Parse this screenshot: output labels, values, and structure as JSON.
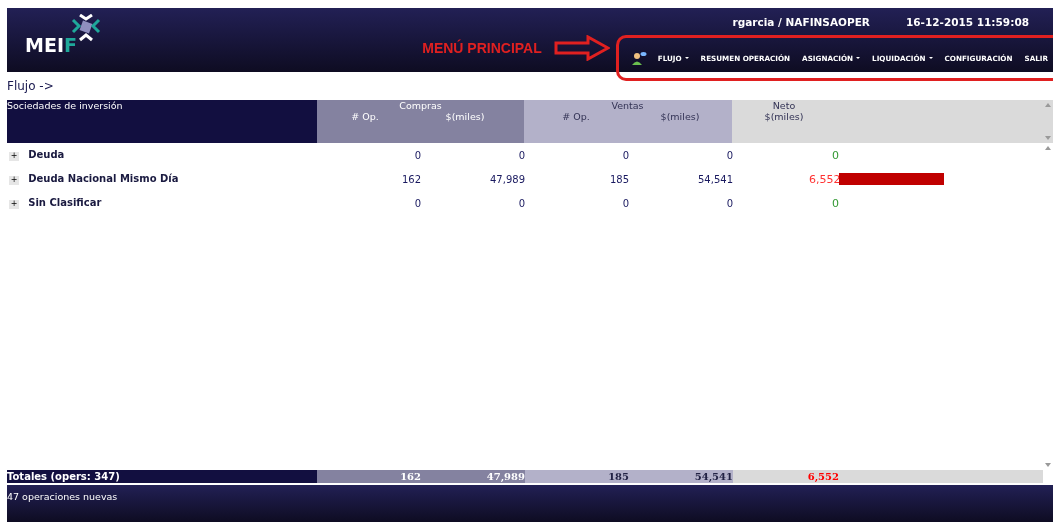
{
  "header": {
    "logo": {
      "text": "MEI",
      "accent": "F"
    },
    "user": "rgarcia / NAFINSAOPER",
    "datetime": "16-12-2015 11:59:08",
    "annotation": "MENÚ PRINCIPAL",
    "menu": [
      {
        "label": "FLUJO",
        "dropdown": true
      },
      {
        "label": "RESUMEN OPERACIÓN",
        "dropdown": false
      },
      {
        "label": "ASIGNACIÓN",
        "dropdown": true
      },
      {
        "label": "LIQUIDACIÓN",
        "dropdown": true
      },
      {
        "label": "CONFIGURACIÓN",
        "dropdown": false
      },
      {
        "label": "SALIR",
        "dropdown": false
      }
    ]
  },
  "breadcrumb": "Flujo ->",
  "table": {
    "name_header": "Sociedades de inversión",
    "groups": [
      {
        "label": "Compras",
        "columns": [
          "# Op.",
          "$(miles)"
        ]
      },
      {
        "label": "Ventas",
        "columns": [
          "# Op.",
          "$(miles)"
        ]
      },
      {
        "label": "Neto",
        "columns": [
          "$(miles)"
        ]
      }
    ],
    "rows": [
      {
        "expand": "+",
        "name": "Deuda",
        "compras_op": "0",
        "compras_monto": "0",
        "ventas_op": "0",
        "ventas_monto": "0",
        "neto": "0",
        "color": "#339933",
        "bar": false
      },
      {
        "expand": "+",
        "name": "Deuda Nacional Mismo Día",
        "compras_op": "162",
        "compras_monto": "47,989",
        "ventas_op": "185",
        "ventas_monto": "54,541",
        "neto": "6,552",
        "color": "#ff3333",
        "bar": true
      },
      {
        "expand": "+",
        "name": "Sin Clasificar",
        "compras_op": "0",
        "compras_monto": "0",
        "ventas_op": "0",
        "ventas_monto": "0",
        "neto": "0",
        "color": "#339933",
        "bar": false
      }
    ],
    "totals": {
      "label": "Totales (opers: 347)",
      "compras_op": "162",
      "compras_monto": "47,989",
      "ventas_op": "185",
      "ventas_monto": "54,541",
      "neto": "6,552",
      "color": "#ff0000"
    }
  },
  "status": "47 operaciones nuevas"
}
